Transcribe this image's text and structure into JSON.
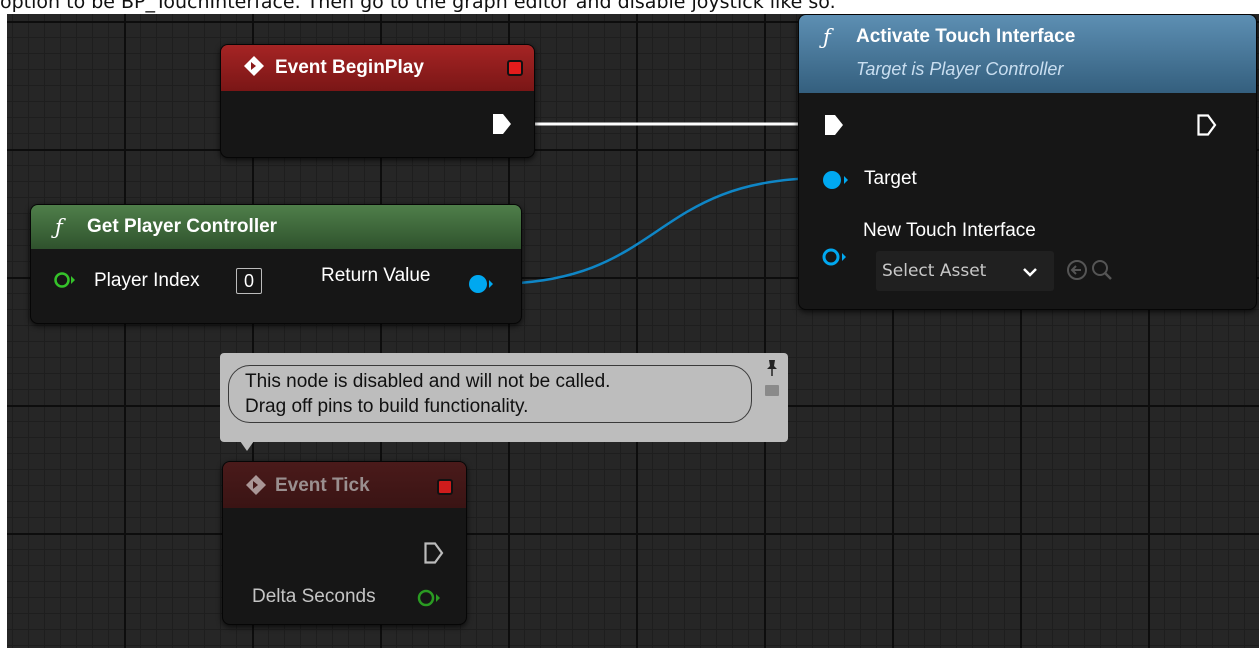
{
  "caption": "option to be BP_TouchInterface. Then go to the graph editor and disable joystick like so.",
  "colors": {
    "event_header": "#8b1a1a",
    "function_header": "#3c6a3c",
    "target_header": "#4d7997",
    "object_pin": "#00a8f0",
    "float_pin": "#35c22a",
    "exec": "#ffffff"
  },
  "nodes": {
    "begin_play": {
      "title": "Event BeginPlay",
      "icon": "event-diamond-icon"
    },
    "get_player_controller": {
      "title": "Get Player Controller",
      "icon": "function-icon",
      "pin_player_index": "Player Index",
      "player_index_value": "0",
      "pin_return_value": "Return Value"
    },
    "activate_touch": {
      "title": "Activate Touch Interface",
      "subtitle": "Target is Player Controller",
      "icon": "function-icon",
      "pin_target": "Target",
      "pin_new_touch": "New Touch Interface",
      "select_asset": "Select Asset"
    },
    "event_tick": {
      "title": "Event Tick",
      "icon": "event-diamond-icon",
      "pin_delta_seconds": "Delta Seconds",
      "disabled": true
    }
  },
  "comment": {
    "line1": "This node is disabled and will not be called.",
    "line2": "Drag off pins to build functionality."
  }
}
